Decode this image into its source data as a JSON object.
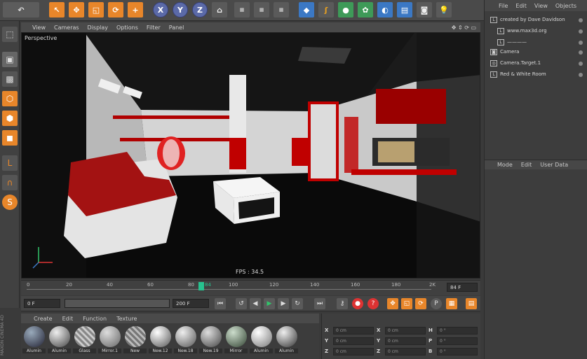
{
  "toolbar": {
    "axis_x": "X",
    "axis_y": "Y",
    "axis_z": "Z"
  },
  "viewport": {
    "menu": [
      "View",
      "Cameras",
      "Display",
      "Options",
      "Filter",
      "Panel"
    ],
    "label": "Perspective",
    "fps": "FPS : 34.5"
  },
  "timeline": {
    "ticks": [
      "0",
      "20",
      "40",
      "60",
      "80",
      "84",
      "100",
      "120",
      "140",
      "160",
      "180",
      "2K"
    ],
    "end_field": "84 F"
  },
  "transport": {
    "start_field": "0 F",
    "range_field": "200 F"
  },
  "materials": {
    "menu": [
      "Create",
      "Edit",
      "Function",
      "Texture"
    ],
    "items": [
      "Alumin",
      "Alumin",
      "Glass",
      "Mirror.1",
      "New",
      "New.12",
      "New.18",
      "New.19",
      "Mirror",
      "Alumin",
      "Alumin"
    ]
  },
  "brand": {
    "vertical": "MAXON CINEMA 4D"
  },
  "coords": {
    "rows": [
      {
        "a": "X",
        "v1": "0 cm",
        "b": "X",
        "v2": "0 cm",
        "c": "H",
        "v3": "0 °"
      },
      {
        "a": "Y",
        "v1": "0 cm",
        "b": "Y",
        "v2": "0 cm",
        "c": "P",
        "v3": "0 °"
      },
      {
        "a": "Z",
        "v1": "0 cm",
        "b": "Z",
        "v2": "0 cm",
        "c": "B",
        "v3": "0 °"
      }
    ]
  },
  "objects_panel": {
    "menu": [
      "File",
      "Edit",
      "View",
      "Objects"
    ],
    "items": [
      "created by Dave Davidson",
      "www.max3d.org",
      "————",
      "Camera",
      "Camera.Target.1",
      "Red & White Room"
    ]
  },
  "attributes_panel": {
    "menu": [
      "Mode",
      "Edit",
      "User Data"
    ]
  }
}
